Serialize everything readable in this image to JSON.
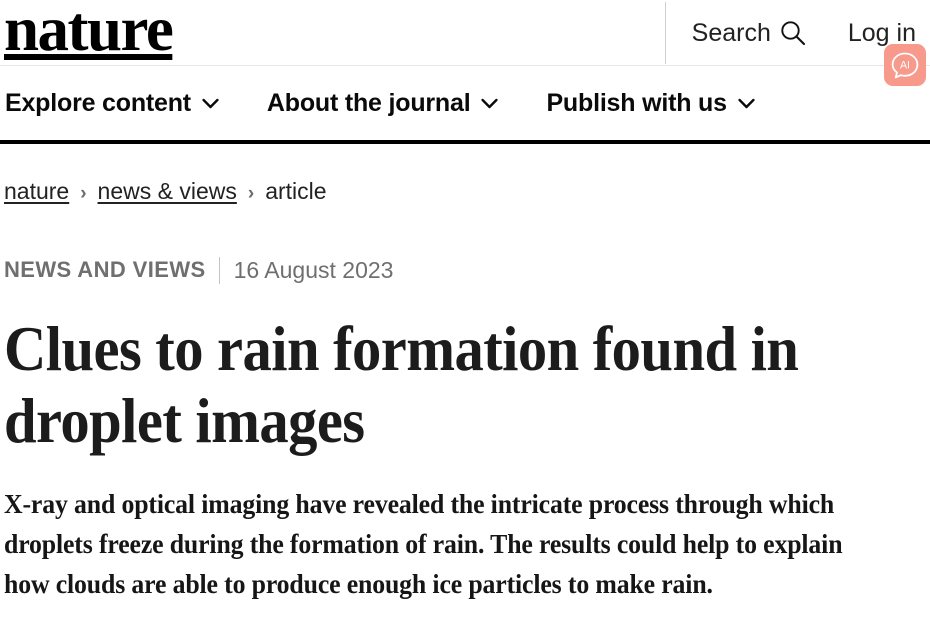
{
  "header": {
    "brand": "nature",
    "search_label": "Search",
    "search_icon": "search-icon",
    "login_label": "Log in",
    "ai_badge_label": "AI",
    "ai_badge_color": "#f79a8c"
  },
  "nav": {
    "items": [
      {
        "label": "Explore content",
        "icon": "chevron-down-icon"
      },
      {
        "label": "About the journal",
        "icon": "chevron-down-icon"
      },
      {
        "label": "Publish with us",
        "icon": "chevron-down-icon"
      }
    ]
  },
  "breadcrumb": {
    "items": [
      {
        "label": "nature",
        "link": true
      },
      {
        "label": "news & views",
        "link": true
      },
      {
        "label": "article",
        "link": false
      }
    ],
    "separator": "›"
  },
  "article": {
    "kicker": "NEWS AND VIEWS",
    "date": "16 August 2023",
    "title": "Clues to rain formation found in droplet images",
    "standfirst": "X-ray and optical imaging have revealed the intricate process through which droplets freeze during the formation of rain. The results could help to explain how clouds are able to produce enough ice particles to make rain."
  },
  "colors": {
    "nav_border": "#000000",
    "header_border": "#e6e6e6",
    "kicker_gray": "#6f6f6f",
    "title_black": "#1c1c1c"
  }
}
